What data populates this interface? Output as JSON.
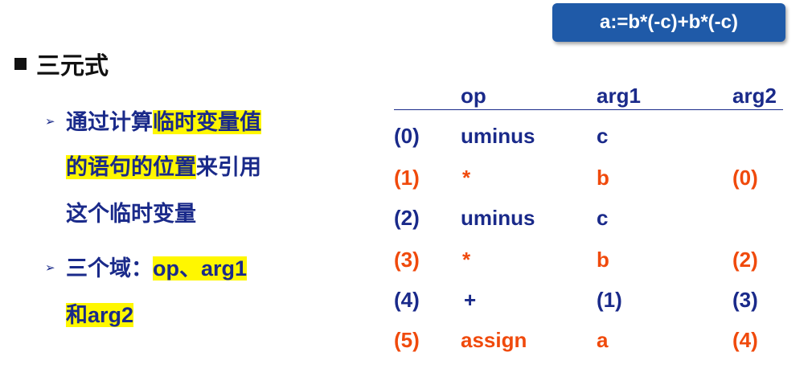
{
  "title_box": "a:=b*(-c)+b*(-c)",
  "heading": "三元式",
  "bullet1": {
    "line1_a": "通过计算",
    "line1_b": "临时变量值",
    "line2_a": "的语句的位置",
    "line2_b": "来引用",
    "line3": "这个临时变量"
  },
  "bullet2": {
    "line1_a": "三个域：",
    "line1_b": "op、arg1",
    "line2": "和arg2"
  },
  "table": {
    "headers": [
      "op",
      "arg1",
      "arg2"
    ],
    "rows": [
      {
        "idx": "(0)",
        "op": "uminus",
        "arg1": "c",
        "arg2": ""
      },
      {
        "idx": "(1)",
        "op": "*",
        "arg1": "b",
        "arg2": "(0)"
      },
      {
        "idx": "(2)",
        "op": "uminus",
        "arg1": "c",
        "arg2": ""
      },
      {
        "idx": "(3)",
        "op": "*",
        "arg1": "b",
        "arg2": "(2)"
      },
      {
        "idx": "(4)",
        "op": "+",
        "arg1": "(1)",
        "arg2": "(3)"
      },
      {
        "idx": "(5)",
        "op": "assign",
        "arg1": "a",
        "arg2": "(4)"
      }
    ]
  },
  "colors": {
    "blue_text": "#1a2a8a",
    "red_text": "#f04a0c",
    "highlight": "#fff700",
    "title_box_bg": "#1f5aa8"
  }
}
